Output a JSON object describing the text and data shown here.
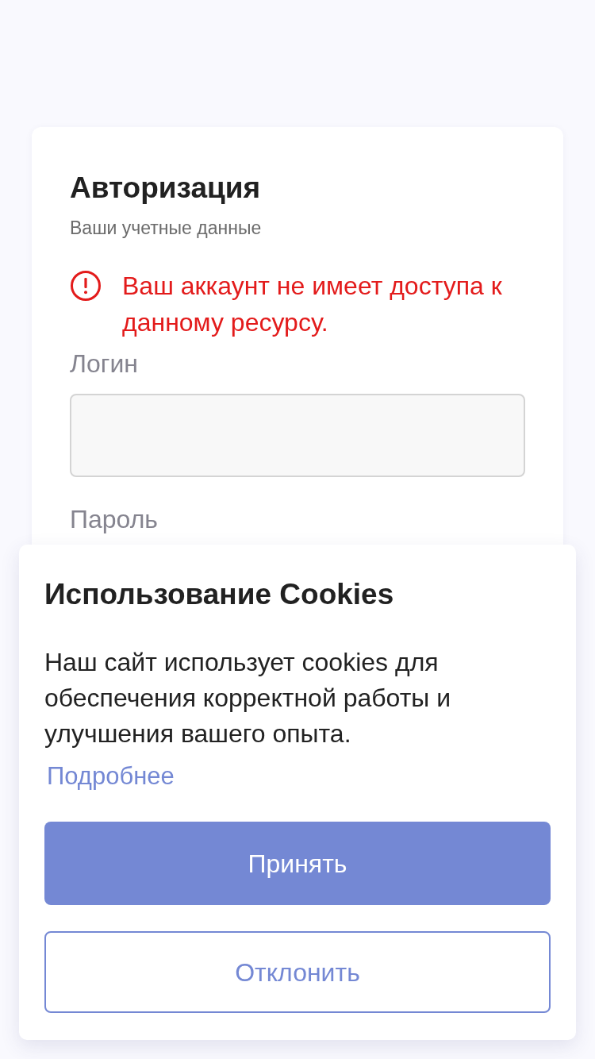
{
  "auth_card": {
    "title": "Авторизация",
    "subtitle": "Ваши учетные данные",
    "error": {
      "text": "Ваш аккаунт не имеет доступа к данному ресурсу."
    },
    "fields": [
      {
        "kind": "input",
        "label": "Логин"
      },
      {
        "kind": "label",
        "label": "Пароль"
      }
    ]
  },
  "cookie_banner": {
    "title": "Использование Cookies",
    "text": "Наш сайт использует cookies для обеспечения корректной работы и улучшения вашего опыта.",
    "link": "Подробнее",
    "buttons": [
      {
        "kind": "primary",
        "label": "Принять"
      },
      {
        "kind": "outline",
        "label": "Отклонить"
      }
    ]
  }
}
